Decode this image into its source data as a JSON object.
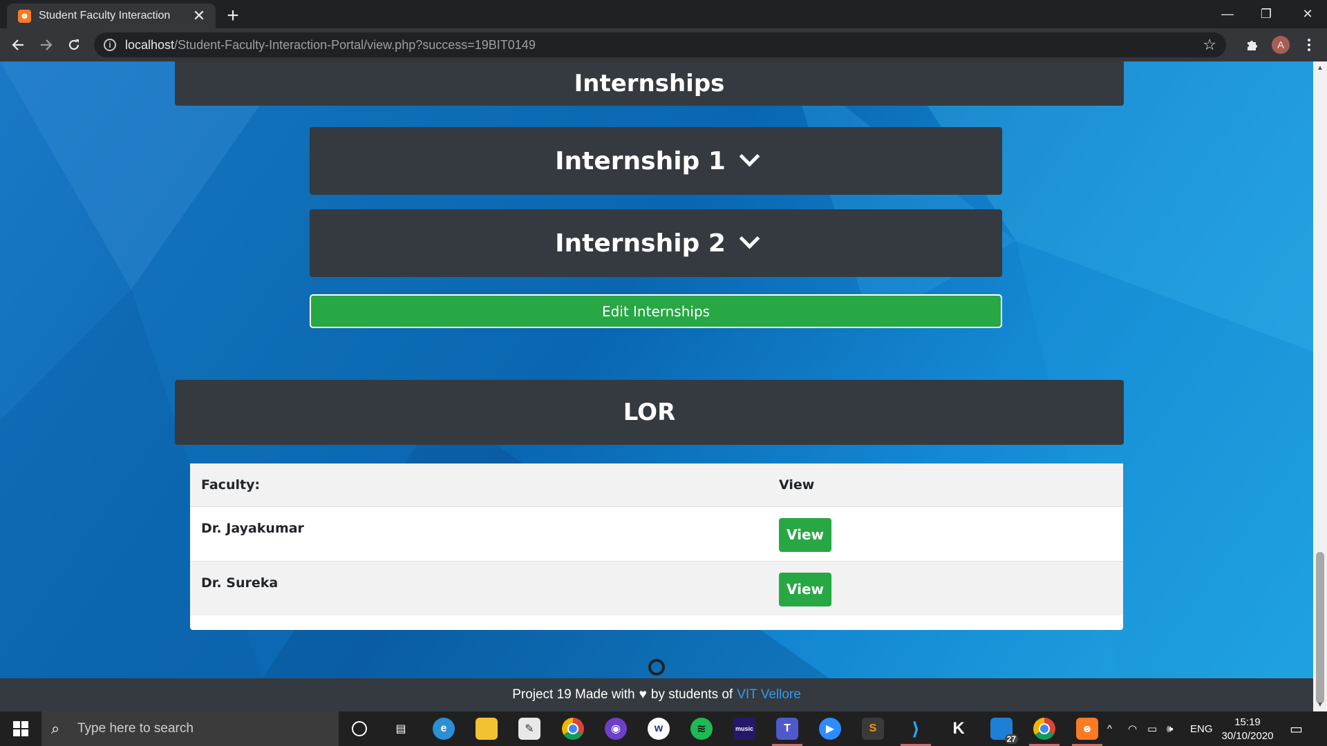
{
  "browser": {
    "tab_title": "Student Faculty Interaction",
    "tab_close": "✕",
    "new_tab": "+",
    "url_host": "localhost",
    "url_path": "/Student-Faculty-Interaction-Portal/view.php?success=19BIT0149",
    "avatar_letter": "A",
    "window_minimize": "—",
    "window_restore": "❐",
    "window_close": "✕"
  },
  "page": {
    "internships_heading": "Internships",
    "internships": [
      {
        "label": "Internship 1"
      },
      {
        "label": "Internship 2"
      }
    ],
    "edit_internships_label": "Edit Internships",
    "lor_heading": "LOR",
    "lor_table": {
      "headers": [
        "Faculty:",
        "View"
      ],
      "rows": [
        {
          "faculty": "Dr. Jayakumar",
          "action": "View"
        },
        {
          "faculty": "Dr. Sureka",
          "action": "View"
        }
      ]
    }
  },
  "footer": {
    "text_before": "Project 19 Made with",
    "heart": "♥",
    "text_after": "by students of",
    "link": "VIT Vellore"
  },
  "taskbar": {
    "search_placeholder": "Type here to search",
    "language": "ENG",
    "time": "15:19",
    "date": "30/10/2020",
    "badge_count": "27",
    "apps": [
      "cortana-icon",
      "task-view-icon",
      "edge-icon",
      "file-explorer-icon",
      "notepad-icon",
      "chrome-icon",
      "github-desktop-icon",
      "whatsapp-icon",
      "spotify-icon",
      "amazon-music-icon",
      "teams-icon",
      "zoom-icon",
      "sublime-text-icon",
      "vscode-icon",
      "kodi-icon",
      "phone-icon",
      "chrome-profile-icon",
      "xampp-icon"
    ]
  },
  "colors": {
    "accent_green": "#28a745",
    "dark_bar": "#343a40",
    "link_blue": "#2f9bf2"
  }
}
